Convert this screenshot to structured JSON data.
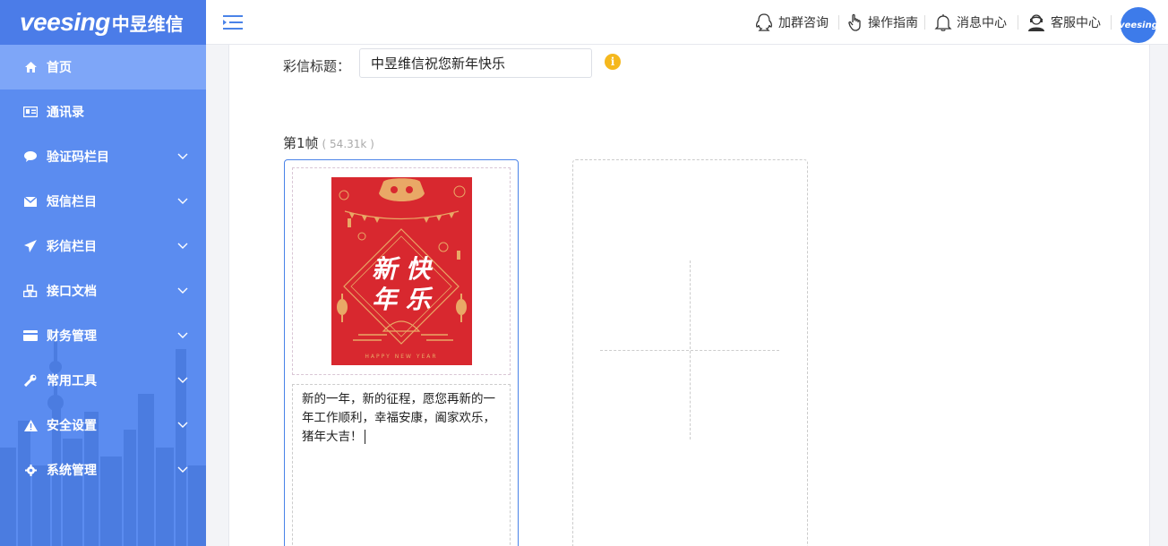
{
  "brand": {
    "logo_text": "veesing",
    "logo_cn": "中昱维信"
  },
  "sidebar": {
    "items": [
      {
        "label": "首页",
        "icon": "home-icon"
      },
      {
        "label": "通讯录",
        "icon": "address-card-icon"
      },
      {
        "label": "验证码栏目",
        "icon": "comment-icon"
      },
      {
        "label": "短信栏目",
        "icon": "envelope-icon"
      },
      {
        "label": "彩信栏目",
        "icon": "paper-plane-icon"
      },
      {
        "label": "接口文档",
        "icon": "cubes-icon"
      },
      {
        "label": "财务管理",
        "icon": "credit-card-icon"
      },
      {
        "label": "常用工具",
        "icon": "wrench-icon"
      },
      {
        "label": "安全设置",
        "icon": "warning-icon"
      },
      {
        "label": "系统管理",
        "icon": "gear-icon"
      }
    ]
  },
  "header": {
    "links": [
      {
        "label": "加群咨询",
        "icon": "qq-icon"
      },
      {
        "label": "操作指南",
        "icon": "hand-pointer-icon"
      },
      {
        "label": "消息中心",
        "icon": "bell-icon"
      },
      {
        "label": "客服中心",
        "icon": "support-agent-icon"
      }
    ],
    "avatar_text": "veesing"
  },
  "mms": {
    "title_label": "彩信标题：",
    "title_value": "中昱维信祝您新年快乐",
    "frame_label": "第1帧",
    "frame_size": "( 54.31k )",
    "card_image": {
      "calligraphy_top": "新 快",
      "calligraphy_bottom": "年 乐",
      "footer": "HAPPY NEW YEAR"
    },
    "frame_text": "新的一年，新的征程，愿您再新的一年工作顺利，幸福安康，阖家欢乐，猪年大吉！"
  },
  "colors": {
    "sidebar_bg": "#5b8cf0",
    "sidebar_active": "#7ea6f8",
    "accent": "#4a83e8",
    "card_red": "#d8282f",
    "info": "#f5b81e"
  }
}
